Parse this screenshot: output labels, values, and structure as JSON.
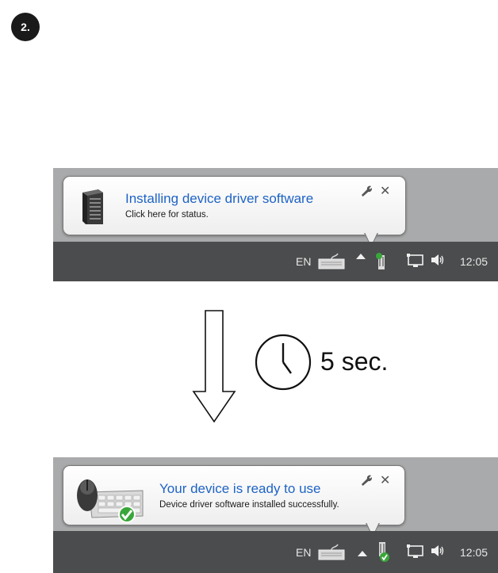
{
  "step": {
    "label": "2."
  },
  "before": {
    "balloon_title": "Installing device driver software",
    "balloon_subtitle": "Click here for status.",
    "tray_language": "EN",
    "tray_time": "12:05"
  },
  "delay": {
    "label": "5 sec."
  },
  "after": {
    "balloon_title": "Your device is ready to use",
    "balloon_subtitle": "Device driver software installed successfully.",
    "tray_language": "EN",
    "tray_time": "12:05"
  },
  "icons": {
    "tower": "computer-tower-icon",
    "mouse_keyboard": "mouse-keyboard-device-icon",
    "check": "checkmark-icon",
    "wrench": "wrench-icon",
    "close": "close-icon",
    "keyboard": "keyboard-icon",
    "show_hidden": "show-hidden-icons-arrow",
    "usb_device": "usb-device-icon",
    "network": "network-icon",
    "volume": "volume-icon",
    "clock": "clock-icon",
    "arrow": "down-arrow-icon"
  },
  "colors": {
    "title_blue": "#1e63c6",
    "taskbar": "#4b4c4d",
    "desktop": "#a9aaab",
    "check_green": "#3aa63a"
  }
}
